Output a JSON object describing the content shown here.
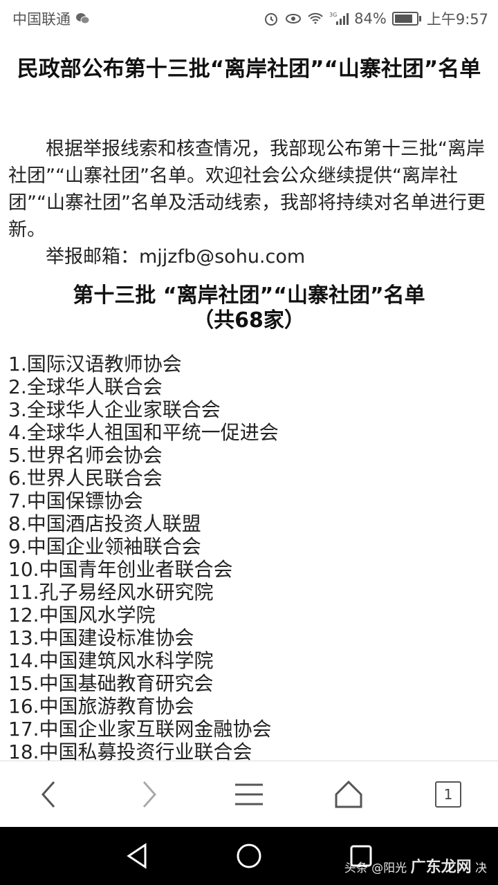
{
  "status_bar": {
    "carrier": "中国联通",
    "battery": "84%",
    "battery_level": 0.84,
    "time": "上午9:57",
    "network": "3G"
  },
  "article": {
    "title": "民政部公布第十三批“离岸社团”“山寨社团”名单",
    "intro": "根据举报线索和核查情况，我部现公布第十三批“离岸社团”“山寨社团”名单。欢迎社会公众继续提供“离岸社团”“山寨社团”名单及活动线索，我部将持续对名单进行更新。",
    "email": "举报邮箱：mjjzfb@sohu.com",
    "list_title": "第十三批 “离岸社团”“山寨社团”名单",
    "list_subtitle": "（共68家）",
    "items": [
      "1.国际汉语教师协会",
      "2.全球华人联合会",
      "3.全球华人企业家联合会",
      "4.全球华人祖国和平统一促进会",
      "5.世界名师会协会",
      "6.世界人民联合会",
      "7.中国保镖协会",
      "8.中国酒店投资人联盟",
      "9.中国企业领袖联合会",
      "10.中国青年创业者联合会",
      "11.孔子易经风水研究院",
      "12.中国风水学院",
      "13.中国建设标准协会",
      "14.中国建筑风水科学院",
      "15.中国基础教育研究会",
      "16.中国旅游教育协会",
      "17.中国企业家互联网金融协会",
      "18.中国私募投资行业联合会"
    ]
  },
  "browser_nav": {
    "tab_count": "1"
  },
  "watermark": {
    "text": "头条 @阳光",
    "brand": "广东龙网",
    "suffix": "决"
  }
}
